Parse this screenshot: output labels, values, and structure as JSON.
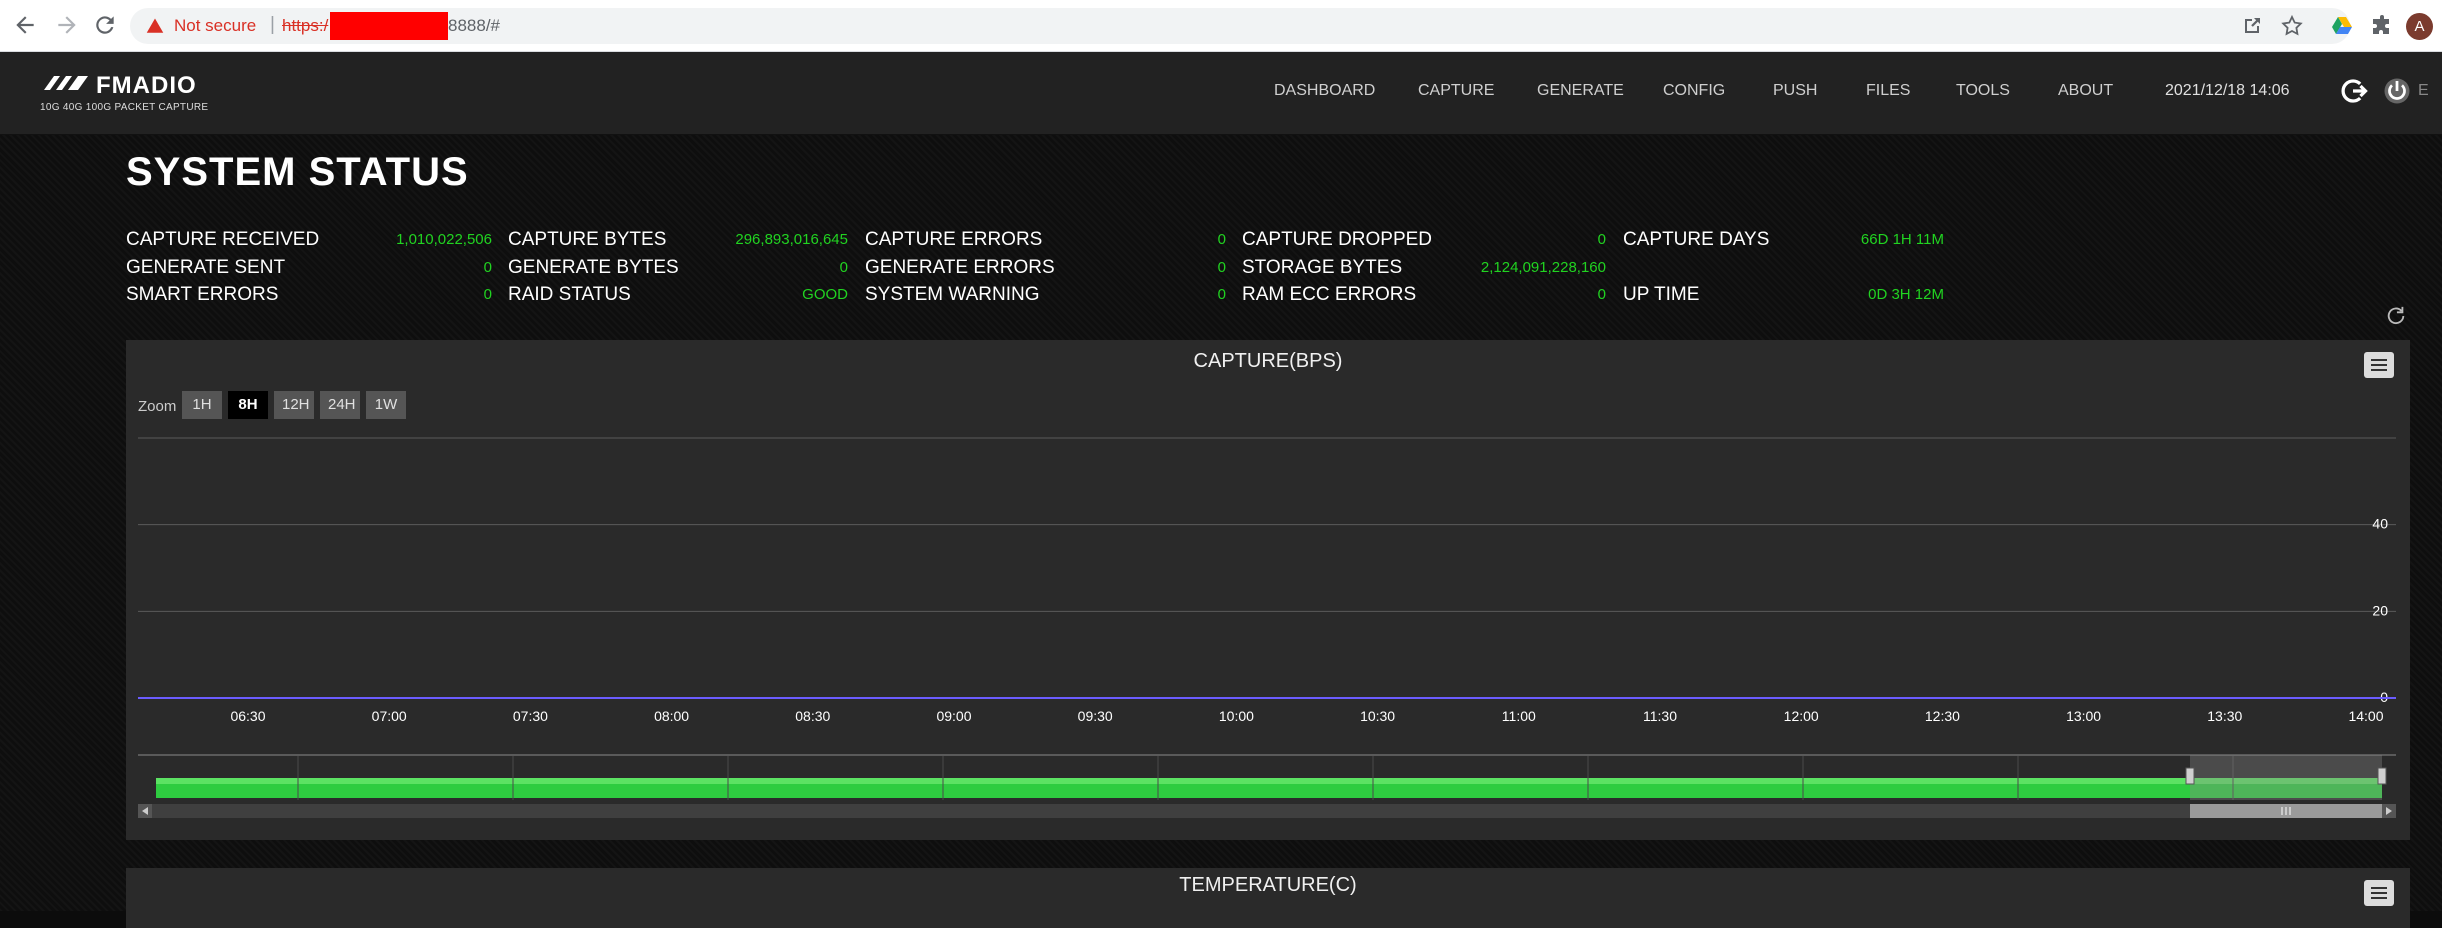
{
  "browser": {
    "not_secure_label": "Not secure",
    "separator": "|",
    "url_scheme": "https:/",
    "url_rest": "8888/#",
    "profile_initial": "A"
  },
  "header": {
    "logo_name": "FMADIO",
    "logo_tagline": "10G 40G 100G PACKET CAPTURE",
    "nav": [
      "DASHBOARD",
      "CAPTURE",
      "GENERATE",
      "CONFIG",
      "PUSH",
      "FILES",
      "TOOLS",
      "ABOUT"
    ],
    "datetime": "2021/12/18 14:06",
    "cut_text": "E"
  },
  "page": {
    "title": "SYSTEM STATUS",
    "stats": [
      {
        "label": "CAPTURE RECEIVED",
        "value": "1,010,022,506"
      },
      {
        "label": "CAPTURE BYTES",
        "value": "296,893,016,645"
      },
      {
        "label": "CAPTURE ERRORS",
        "value": "0"
      },
      {
        "label": "CAPTURE DROPPED",
        "value": "0"
      },
      {
        "label": "CAPTURE DAYS",
        "value": "66D 1H 11M"
      },
      {
        "label": "GENERATE SENT",
        "value": "0"
      },
      {
        "label": "GENERATE BYTES",
        "value": "0"
      },
      {
        "label": "GENERATE ERRORS",
        "value": "0"
      },
      {
        "label": "STORAGE BYTES",
        "value": "2,124,091,228,160"
      },
      {
        "label": "SMART ERRORS",
        "value": "0"
      },
      {
        "label": "RAID STATUS",
        "value": "GOOD"
      },
      {
        "label": "SYSTEM WARNING",
        "value": "0"
      },
      {
        "label": "RAM ECC ERRORS",
        "value": "0"
      },
      {
        "label": "UP TIME",
        "value": "0D 3H 12M"
      }
    ]
  },
  "capture_panel": {
    "title": "CAPTURE(BPS)",
    "zoom_label": "Zoom",
    "zoom_buttons": [
      "1H",
      "8H",
      "12H",
      "24H",
      "1W"
    ],
    "active_zoom": "8H"
  },
  "temperature_panel": {
    "title": "TEMPERATURE(C)"
  },
  "colors": {
    "accent_green": "#21d321",
    "series_line": "#6b5cff",
    "navigator_fill": "#2ecc40"
  },
  "chart_data": {
    "type": "line",
    "title": "CAPTURE(BPS)",
    "x_tick_labels": [
      "06:30",
      "07:00",
      "07:30",
      "08:00",
      "08:30",
      "09:00",
      "09:30",
      "10:00",
      "10:30",
      "11:00",
      "11:30",
      "12:00",
      "12:30",
      "13:00",
      "13:30",
      "14:00"
    ],
    "y_tick_labels": [
      "0",
      "20",
      "40"
    ],
    "ylim": [
      0,
      60
    ],
    "grid": true,
    "series": [
      {
        "x": [
          "06:30",
          "14:00"
        ],
        "values": [
          0,
          0
        ]
      }
    ]
  }
}
